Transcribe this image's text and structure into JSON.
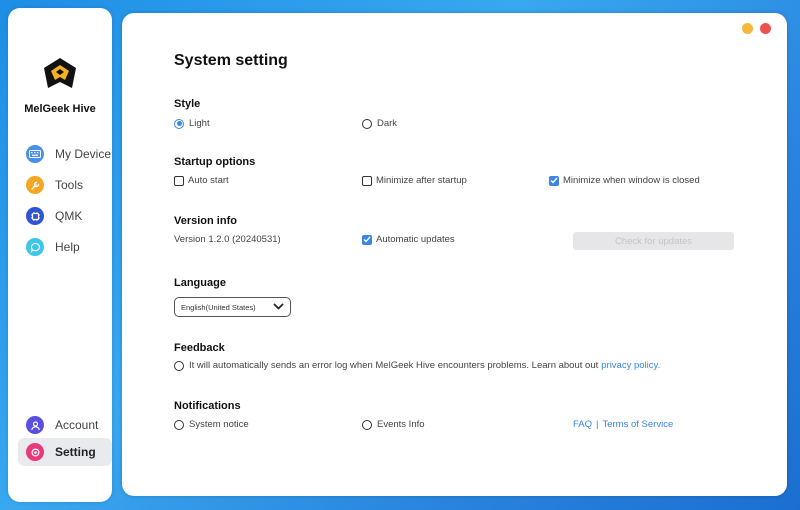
{
  "app": {
    "name": "MelGeek Hive"
  },
  "sidebar": {
    "items": [
      {
        "label": "My Device",
        "icon": "keyboard-icon",
        "color": "#4a8fe8"
      },
      {
        "label": "Tools",
        "icon": "tools-icon",
        "color": "#f5a623"
      },
      {
        "label": "QMK",
        "icon": "qmk-chip-icon",
        "color": "#2f55d4"
      },
      {
        "label": "Help",
        "icon": "chat-bubble-icon",
        "color": "#3ec6e8"
      }
    ],
    "bottom_items": [
      {
        "label": "Account",
        "icon": "user-icon",
        "color": "#5a4fe0"
      },
      {
        "label": "Setting",
        "icon": "settings-icon",
        "color": "#e83a7a",
        "active": true
      }
    ]
  },
  "page": {
    "title": "System setting"
  },
  "style": {
    "title": "Style",
    "options": [
      {
        "label": "Light",
        "selected": true
      },
      {
        "label": "Dark",
        "selected": false
      }
    ]
  },
  "startup": {
    "title": "Startup options",
    "options": [
      {
        "label": "Auto start",
        "checked": false
      },
      {
        "label": "Minimize after startup",
        "checked": false
      },
      {
        "label": "Minimize when window is closed",
        "checked": true
      }
    ]
  },
  "version": {
    "title": "Version info",
    "text": "Version 1.2.0 (20240531)",
    "auto_update_label": "Automatic updates",
    "auto_update_checked": true,
    "check_button": "Check for updates"
  },
  "language": {
    "title": "Language",
    "selected": "English(United States)"
  },
  "feedback": {
    "title": "Feedback",
    "text": "It will automatically sends an error log when MelGeek Hive encounters problems. Learn about out",
    "link": "privacy policy.",
    "checked": false
  },
  "notifications": {
    "title": "Notifications",
    "options": [
      {
        "label": "System notice",
        "checked": false
      },
      {
        "label": "Events Info",
        "checked": false
      }
    ],
    "faq_link": "FAQ",
    "separator": "|",
    "terms_link": "Terms of Service"
  },
  "colors": {
    "accent": "#3a86e6",
    "window_minimize": "#f5b83c",
    "window_close": "#ef5050"
  }
}
